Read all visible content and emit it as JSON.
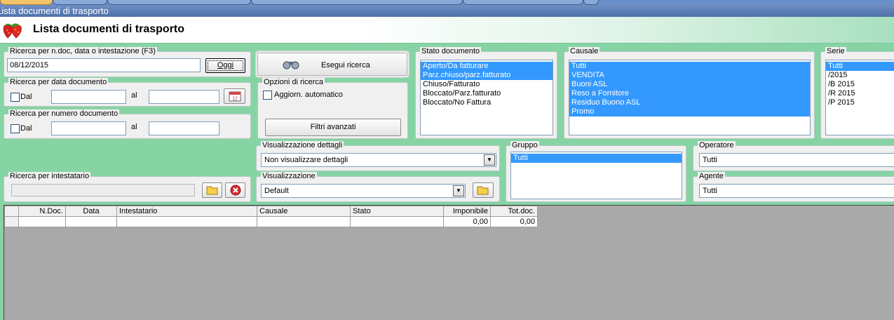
{
  "window": {
    "title": "Lista documenti di trasporto"
  },
  "header": {
    "title": "Lista documenti di trasporto",
    "logo_icon": "strawberry-icon"
  },
  "search_quick": {
    "label": "Ricerca per n.doc, data o intestazione (F3)",
    "value": "08/12/2015",
    "today_button": "Oggi"
  },
  "search_date": {
    "label": "Ricerca per data documento",
    "from_label": "Dal",
    "to_label": "al",
    "from_value": "",
    "to_value": ""
  },
  "search_number": {
    "label": "Ricerca per numero documento",
    "from_label": "Dal",
    "to_label": "al",
    "from_value": "",
    "to_value": ""
  },
  "search_holder": {
    "label": "Ricerca per intestatario",
    "value": ""
  },
  "run_search": {
    "label": "Esegui ricerca"
  },
  "search_options": {
    "label": "Opzioni di ricerca",
    "auto_update_label": "Aggiorn. automatico",
    "auto_update_checked": false,
    "advanced_filters_label": "Filtri avanzati"
  },
  "doc_state": {
    "label": "Stato documento",
    "items": [
      {
        "text": "Aperto/Da fatturare",
        "selected": true
      },
      {
        "text": "Parz.chiuso/parz.fatturato",
        "selected": true
      },
      {
        "text": "Chiuso/Fatturato",
        "selected": false
      },
      {
        "text": "Bloccato/Parz.fatturato",
        "selected": false
      },
      {
        "text": "Bloccato/No Fattura",
        "selected": false
      }
    ]
  },
  "causale": {
    "label": "Causale",
    "items": [
      {
        "text": "Tutti",
        "selected": true
      },
      {
        "text": "VENDITA",
        "selected": true
      },
      {
        "text": "Buoni ASL",
        "selected": true
      },
      {
        "text": "Reso a Fornitore",
        "selected": true
      },
      {
        "text": "Residuo Buono ASL",
        "selected": true
      },
      {
        "text": "Promo",
        "selected": true
      }
    ]
  },
  "serie": {
    "label": "Serie",
    "items": [
      {
        "text": "Tutti",
        "selected": true
      },
      {
        "text": "/2015",
        "selected": false
      },
      {
        "text": "/B 2015",
        "selected": false
      },
      {
        "text": " /R 2015",
        "selected": false
      },
      {
        "text": " /P 2015",
        "selected": false
      }
    ]
  },
  "detail_view": {
    "label": "Visualizzazione dettagli",
    "value": "Non visualizzare dettagli"
  },
  "view": {
    "label": "Visualizzazione",
    "value": "Default"
  },
  "group": {
    "label": "Gruppo",
    "items": [
      {
        "text": "Tutti",
        "selected": true
      }
    ]
  },
  "operator": {
    "label": "Operatore",
    "value": "Tutti"
  },
  "agent": {
    "label": "Agente",
    "value": "Tutti"
  },
  "grid": {
    "columns": [
      "",
      "N.Doc.",
      "Data",
      "Intestatario",
      "Causale",
      "Stato",
      "Imponibile",
      "Tot.doc."
    ],
    "rows": [
      [
        "",
        "",
        "",
        "",
        "",
        "",
        "0,00",
        "0,00"
      ]
    ]
  },
  "colors": {
    "background": "#86d4a4",
    "selection": "#3399ff",
    "title_bar": "#4e70aa"
  }
}
